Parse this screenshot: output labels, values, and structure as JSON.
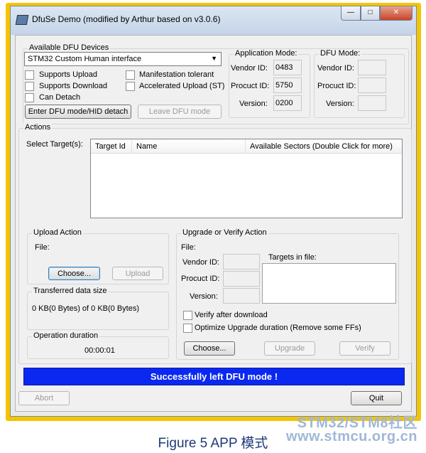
{
  "window": {
    "title": "DfuSe Demo (modified by Arthur based on v3.0.6)",
    "controls": {
      "minimize": "—",
      "maximize": "□",
      "close": "✕"
    }
  },
  "devices": {
    "group_label": "Available DFU Devices",
    "selected_device": "STM32 Custom Human interface",
    "checkboxes": {
      "supports_upload": "Supports Upload",
      "supports_download": "Supports Download",
      "can_detach": "Can Detach",
      "manifestation_tolerant": "Manifestation tolerant",
      "accelerated_upload": "Accelerated Upload (ST)"
    },
    "enter_dfu_button": "Enter DFU mode/HID detach",
    "leave_dfu_button": "Leave DFU mode"
  },
  "app_mode": {
    "group_label": "Application Mode:",
    "vendor_label": "Vendor ID:",
    "vendor_value": "0483",
    "product_label": "Procuct ID:",
    "product_value": "5750",
    "version_label": "Version:",
    "version_value": "0200"
  },
  "dfu_mode": {
    "group_label": "DFU Mode:",
    "vendor_label": "Vendor ID:",
    "product_label": "Procuct ID:",
    "version_label": "Version:"
  },
  "actions": {
    "group_label": "Actions",
    "select_targets_label": "Select Target(s):",
    "columns": [
      "Target Id",
      "Name",
      "Available Sectors (Double Click for more)"
    ]
  },
  "upload_action": {
    "group_label": "Upload Action",
    "file_label": "File:",
    "choose_button": "Choose...",
    "upload_button": "Upload"
  },
  "transferred": {
    "group_label": "Transferred data size",
    "value": "0 KB(0 Bytes) of 0 KB(0 Bytes)"
  },
  "operation": {
    "group_label": "Operation duration",
    "value": "00:00:01"
  },
  "upgrade_verify": {
    "group_label": "Upgrade or Verify Action",
    "file_label": "File:",
    "vendor_label": "Vendor ID:",
    "product_label": "Procuct ID:",
    "version_label": "Version:",
    "targets_label": "Targets in file:",
    "verify_after_download": "Verify after download",
    "optimize_upgrade": "Optimize Upgrade duration (Remove some FFs)",
    "choose_button": "Choose...",
    "upgrade_button": "Upgrade",
    "verify_button": "Verify"
  },
  "status": {
    "message": "Successfully left DFU mode !"
  },
  "footer": {
    "abort_button": "Abort",
    "quit_button": "Quit"
  },
  "watermark": {
    "line1": "STM32/STM8社区",
    "line2": "www.stmcu.org.cn"
  },
  "caption": "Figure 5 APP 模式"
}
